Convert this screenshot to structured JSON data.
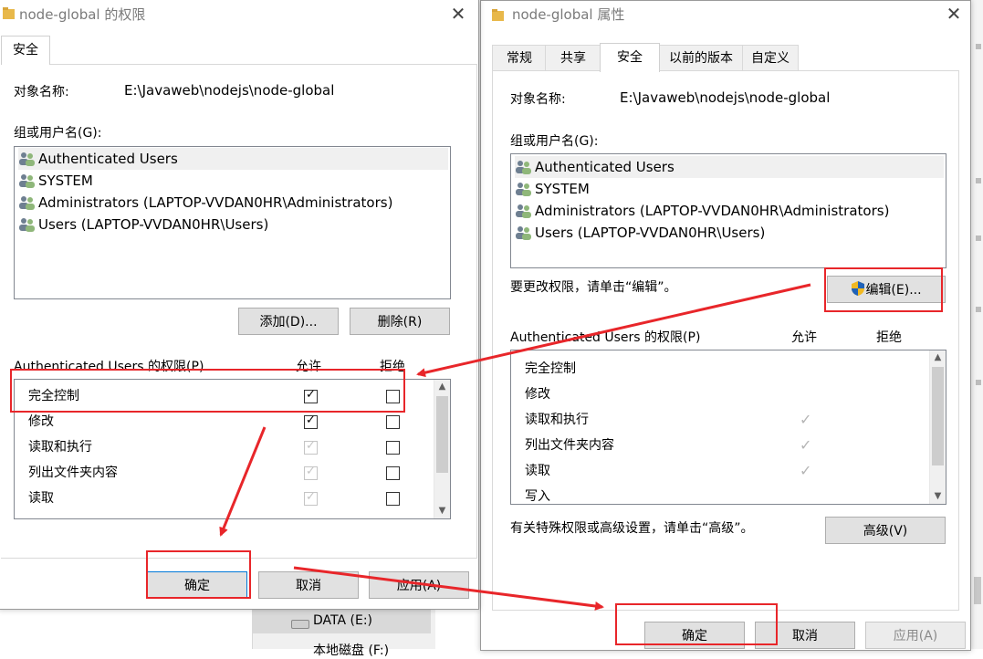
{
  "background": {
    "drive_label": "DATA (E:)",
    "next_drive_label": "本地磁盘 (F:)"
  },
  "left_window": {
    "title": "node-global 的权限",
    "tabs": [
      "安全"
    ],
    "object_label": "对象名称:",
    "object_value": "E:\\Javaweb\\nodejs\\node-global",
    "groups_label": "组或用户名(G):",
    "users": [
      "Authenticated Users",
      "SYSTEM",
      "Administrators (LAPTOP-VVDAN0HR\\Administrators)",
      "Users (LAPTOP-VVDAN0HR\\Users)"
    ],
    "add_button": "添加(D)...",
    "remove_button": "删除(R)",
    "perm_header": "Authenticated Users 的权限(P)",
    "allow_header": "允许",
    "deny_header": "拒绝",
    "permissions": [
      {
        "name": "完全控制",
        "allow": "checked",
        "deny": "unchecked"
      },
      {
        "name": "修改",
        "allow": "checked",
        "deny": "unchecked"
      },
      {
        "name": "读取和执行",
        "allow": "checked-disabled",
        "deny": "unchecked"
      },
      {
        "name": "列出文件夹内容",
        "allow": "checked-disabled",
        "deny": "unchecked"
      },
      {
        "name": "读取",
        "allow": "checked-disabled",
        "deny": "unchecked"
      }
    ],
    "ok_button": "确定",
    "cancel_button": "取消",
    "apply_button": "应用(A)"
  },
  "right_window": {
    "title": "node-global 属性",
    "tabs": [
      "常规",
      "共享",
      "安全",
      "以前的版本",
      "自定义"
    ],
    "active_tab": "安全",
    "object_label": "对象名称:",
    "object_value": "E:\\Javaweb\\nodejs\\node-global",
    "groups_label": "组或用户名(G):",
    "users": [
      "Authenticated Users",
      "SYSTEM",
      "Administrators (LAPTOP-VVDAN0HR\\Administrators)",
      "Users (LAPTOP-VVDAN0HR\\Users)"
    ],
    "edit_hint": "要更改权限，请单击“编辑”。",
    "edit_button": "编辑(E)...",
    "perm_header": "Authenticated Users 的权限(P)",
    "allow_header": "允许",
    "deny_header": "拒绝",
    "permissions": [
      {
        "name": "完全控制",
        "allow": false
      },
      {
        "name": "修改",
        "allow": false
      },
      {
        "name": "读取和执行",
        "allow": true
      },
      {
        "name": "列出文件夹内容",
        "allow": true
      },
      {
        "name": "读取",
        "allow": true
      },
      {
        "name": "写入",
        "allow": false
      }
    ],
    "advanced_hint": "有关特殊权限或高级设置，请单击“高级”。",
    "advanced_button": "高级(V)",
    "ok_button": "确定",
    "cancel_button": "取消",
    "apply_button": "应用(A)"
  },
  "colors": {
    "highlight_red": "#e8262a",
    "focus_blue": "#0078d7"
  }
}
